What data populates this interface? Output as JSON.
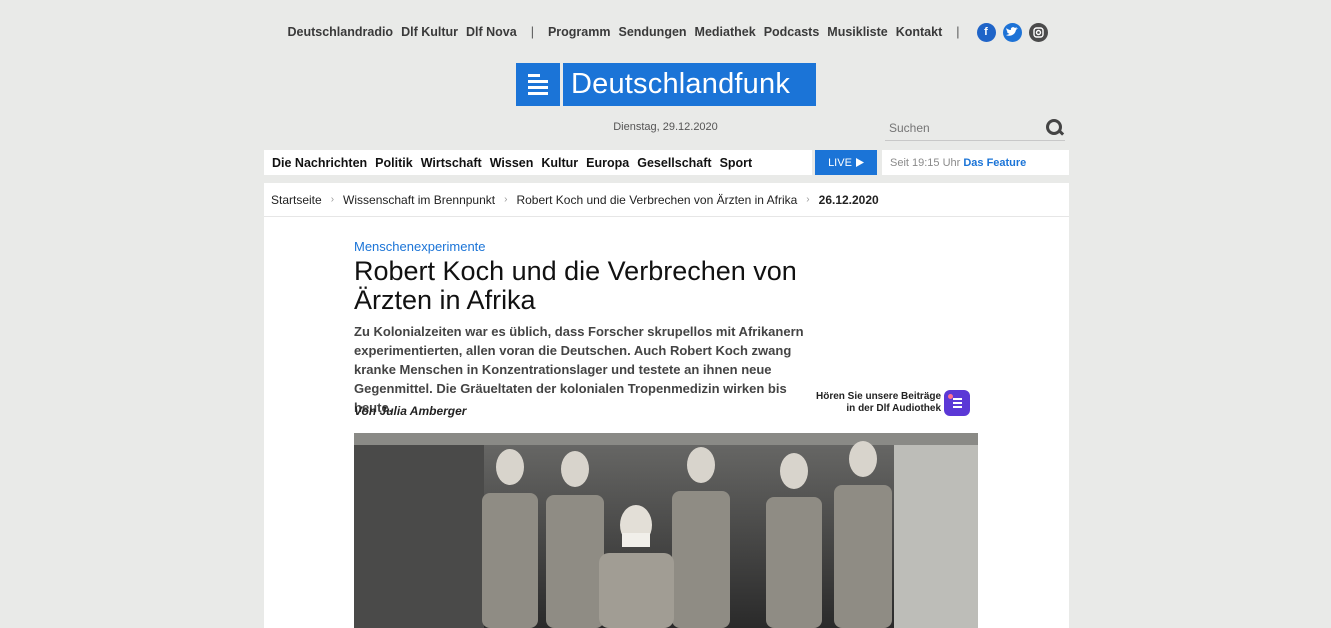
{
  "topnav": {
    "links": [
      "Deutschlandradio",
      "Dlf Kultur",
      "Dlf Nova"
    ],
    "separator": "|",
    "sections": [
      "Programm",
      "Sendungen",
      "Mediathek",
      "Podcasts",
      "Musikliste",
      "Kontakt"
    ],
    "social_separator": "|",
    "social": [
      "facebook-icon",
      "twitter-icon",
      "instagram-icon"
    ]
  },
  "brand": {
    "name": "Deutschlandfunk",
    "color": "#1b74d7"
  },
  "date": "Dienstag, 29.12.2020",
  "search": {
    "placeholder": "Suchen"
  },
  "mainnav": [
    "Die Nachrichten",
    "Politik",
    "Wirtschaft",
    "Wissen",
    "Kultur",
    "Europa",
    "Gesellschaft",
    "Sport"
  ],
  "live": {
    "label": "LIVE",
    "time": "Seit 19:15 Uhr",
    "program": "Das Feature"
  },
  "breadcrumb": [
    "Startseite",
    "Wissenschaft im Brennpunkt",
    "Robert Koch und die Verbrechen von Ärzten in Afrika",
    "26.12.2020"
  ],
  "article": {
    "kicker": "Menschenexperimente",
    "title": "Robert Koch und die Verbrechen von Ärzten in Afrika",
    "teaser": "Zu Kolonialzeiten war es üblich, dass Forscher skrupellos mit Afrikanern experimentierten, allen voran die Deutschen. Auch Robert Koch zwang kranke Menschen in Konzentrationslager und testete an ihnen neue Gegenmittel. Die Gräueltaten der kolonialen Tropenmedizin wirken bis heute.",
    "author": "Von Julia Amberger",
    "audiothek": {
      "line1": "Hören Sie unsere Beiträge",
      "line2": "in der Dlf Audiothek"
    }
  }
}
